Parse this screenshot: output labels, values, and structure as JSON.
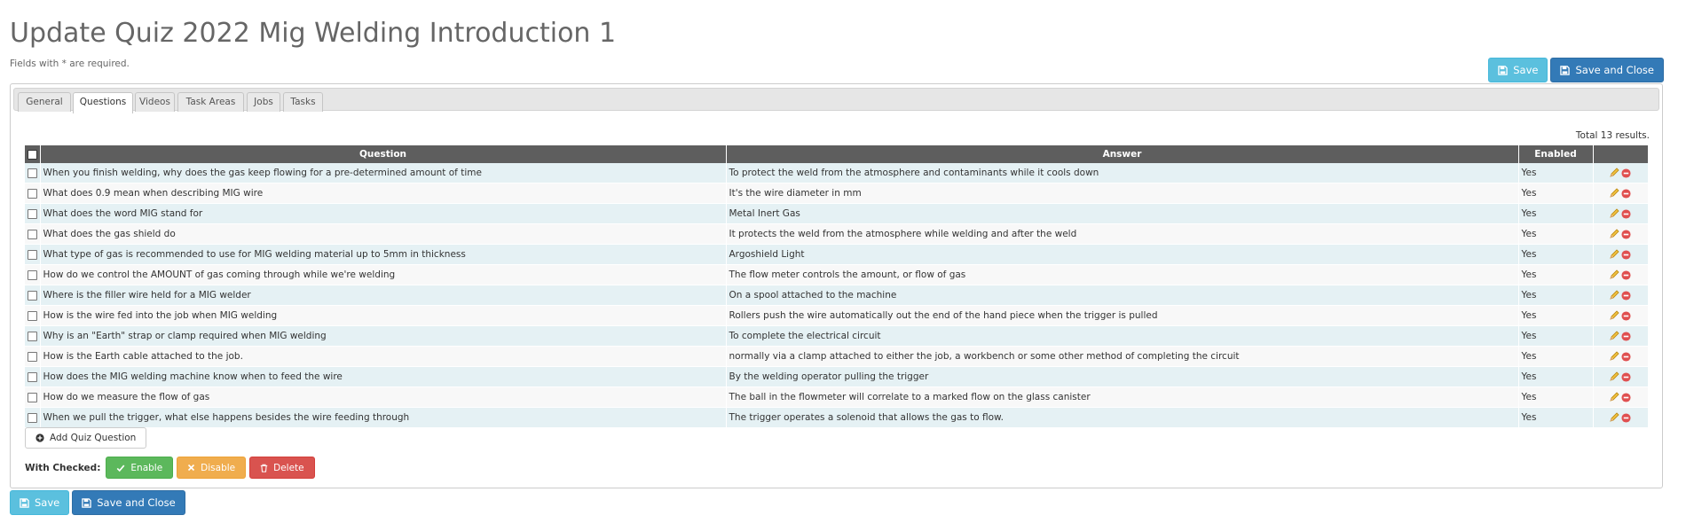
{
  "page": {
    "title": "Update Quiz 2022 Mig Welding Introduction 1",
    "hint": "Fields with * are required."
  },
  "actions": {
    "save_label": "Save",
    "save_close_label": "Save and Close"
  },
  "tabs": [
    {
      "label": "General",
      "active": false
    },
    {
      "label": "Questions",
      "active": true
    },
    {
      "label": "Videos",
      "active": false
    },
    {
      "label": "Task Areas",
      "active": false
    },
    {
      "label": "Jobs",
      "active": false
    },
    {
      "label": "Tasks",
      "active": false
    }
  ],
  "grid": {
    "summary": "Total 13 results.",
    "columns": {
      "question": "Question",
      "answer": "Answer",
      "enabled": "Enabled"
    },
    "rows": [
      {
        "question": "When you finish welding, why does the gas keep flowing for a pre-determined amount of time",
        "answer": "To protect the weld from the atmosphere and contaminants while it cools down",
        "enabled": "Yes"
      },
      {
        "question": "What does 0.9 mean when describing MIG wire",
        "answer": "It's the wire diameter in mm",
        "enabled": "Yes"
      },
      {
        "question": "What does the word MIG stand for",
        "answer": "Metal Inert Gas",
        "enabled": "Yes"
      },
      {
        "question": "What does the gas shield do",
        "answer": "It protects the weld from the atmosphere while welding and after the weld",
        "enabled": "Yes"
      },
      {
        "question": "What type of gas is recommended to use for MIG welding material up to 5mm in thickness",
        "answer": "Argoshield Light",
        "enabled": "Yes"
      },
      {
        "question": "How do we control the AMOUNT of gas coming through while we're welding",
        "answer": "The flow meter controls the amount, or flow of gas",
        "enabled": "Yes"
      },
      {
        "question": "Where is the filler wire held for a MIG welder",
        "answer": "On a spool attached to the machine",
        "enabled": "Yes"
      },
      {
        "question": "How is the wire fed into the job when MIG welding",
        "answer": "Rollers push the wire automatically out the end of the hand piece when the trigger is pulled",
        "enabled": "Yes"
      },
      {
        "question": "Why is an \"Earth\" strap or clamp required when MIG welding",
        "answer": "To complete the electrical circuit",
        "enabled": "Yes"
      },
      {
        "question": "How is the Earth cable attached to the job.",
        "answer": "normally via a clamp attached to either the job, a workbench or some other method of completing the circuit",
        "enabled": "Yes"
      },
      {
        "question": "How does the MIG welding machine know when to feed the wire",
        "answer": "By the welding operator pulling the trigger",
        "enabled": "Yes"
      },
      {
        "question": "How do we measure the flow of gas",
        "answer": "The ball in the flowmeter will correlate to a marked flow on the glass canister",
        "enabled": "Yes"
      },
      {
        "question": "When we pull the trigger, what else happens besides the wire feeding through",
        "answer": "The trigger operates a solenoid that allows the gas to flow.",
        "enabled": "Yes"
      }
    ]
  },
  "add_question_label": "Add Quiz Question",
  "bulk": {
    "label": "With Checked:",
    "enable_label": "Enable",
    "disable_label": "Disable",
    "delete_label": "Delete"
  },
  "icons": {
    "save": "floppy-icon",
    "add": "plus-circle-icon",
    "enable": "check-icon",
    "disable": "times-icon",
    "delete": "trash-icon",
    "edit": "pencil-icon",
    "remove": "minus-circle-icon"
  },
  "colors": {
    "info": "#5bc0de",
    "primary": "#337ab7",
    "success": "#5cb85c",
    "warning": "#f0ad4e",
    "danger": "#d9534f",
    "header": "#5e5e5e",
    "row_odd": "#e5f1f4",
    "row_even": "#f8f8f8"
  }
}
